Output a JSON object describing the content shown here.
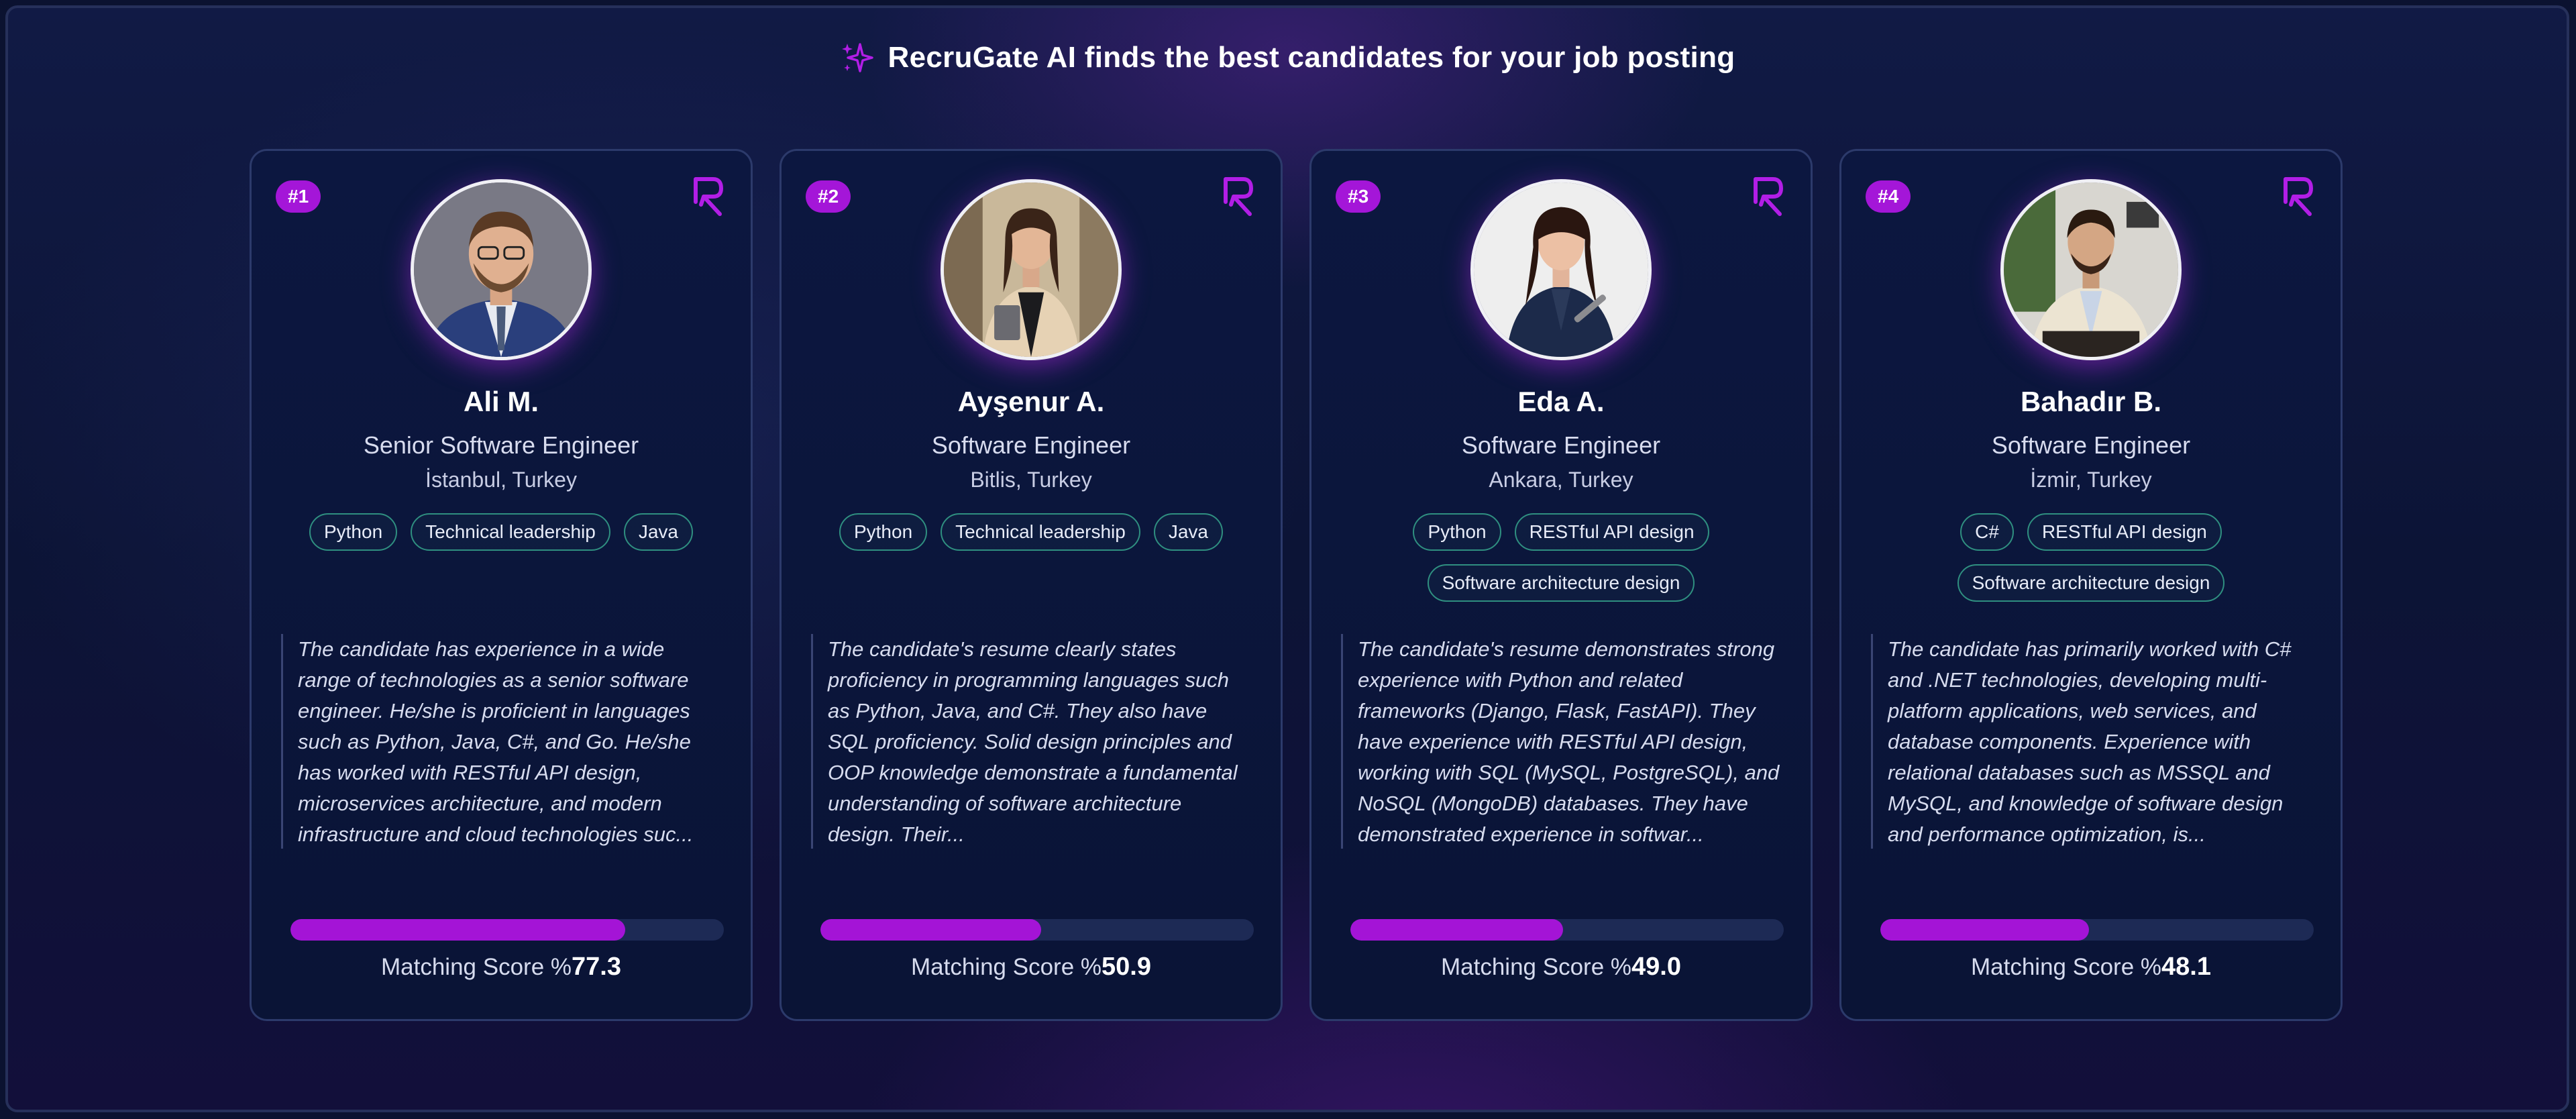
{
  "header": {
    "title": "RecruGate AI finds the best candidates for your job posting",
    "icon": "sparkle-icon",
    "accent": "#b21ee6"
  },
  "score_label": "Matching Score %",
  "candidates": [
    {
      "rank": "#1",
      "name": "Ali M.",
      "title": "Senior Software Engineer",
      "location": "İstanbul, Turkey",
      "tags": [
        "Python",
        "Technical leadership",
        "Java"
      ],
      "description": "The candidate has experience in a wide range of technologies as a senior software engineer. He/she is proficient in languages such as Python, Java, C#, and Go. He/she has worked with RESTful API design, microservices architecture, and modern infrastructure and cloud technologies suc...",
      "score": "77.3",
      "score_fraction": 0.773
    },
    {
      "rank": "#2",
      "name": "Ayşenur A.",
      "title": "Software Engineer",
      "location": "Bitlis, Turkey",
      "tags": [
        "Python",
        "Technical leadership",
        "Java"
      ],
      "description": "The candidate's resume clearly states proficiency in programming languages such as Python, Java, and C#. They also have SQL proficiency. Solid design principles and OOP knowledge demonstrate a fundamental understanding of software architecture design. Their...",
      "score": "50.9",
      "score_fraction": 0.509
    },
    {
      "rank": "#3",
      "name": "Eda A.",
      "title": "Software Engineer",
      "location": "Ankara, Turkey",
      "tags": [
        "Python",
        "RESTful API design",
        "Software architecture design"
      ],
      "description": "The candidate's resume demonstrates strong experience with Python and related frameworks (Django, Flask, FastAPI). They have experience with RESTful API design, working with SQL (MySQL, PostgreSQL), and NoSQL (MongoDB) databases. They have demonstrated experience in softwar...",
      "score": "49.0",
      "score_fraction": 0.49
    },
    {
      "rank": "#4",
      "name": "Bahadır B.",
      "title": "Software Engineer",
      "location": "İzmir, Turkey",
      "tags": [
        "C#",
        "RESTful API design",
        "Software architecture design"
      ],
      "description": "The candidate has primarily worked with C# and .NET technologies, developing multi-platform applications, web services, and database components. Experience with relational databases such as MSSQL and MySQL, and knowledge of software design and performance optimization, is...",
      "score": "48.1",
      "score_fraction": 0.481
    }
  ]
}
